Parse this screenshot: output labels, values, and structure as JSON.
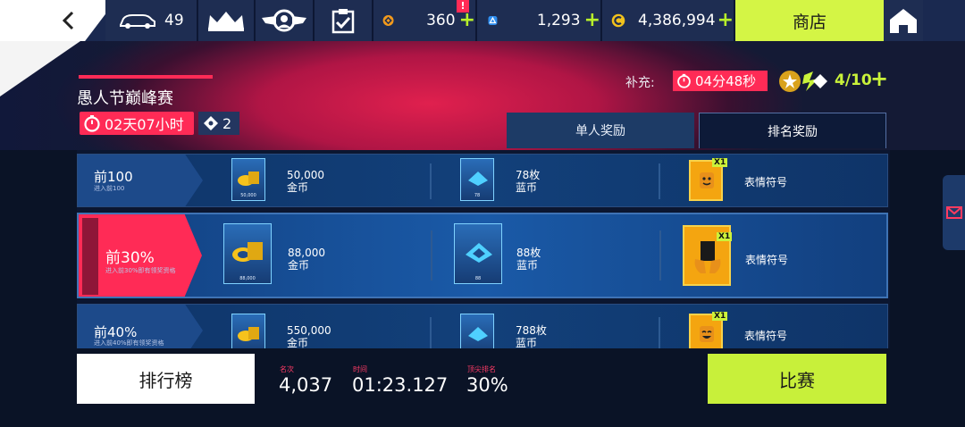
{
  "topbar": {
    "car_count": "49",
    "tokens": "360",
    "blueprints": "1,293",
    "credits": "4,386,994",
    "shop_label": "商店",
    "alert_badge": "!"
  },
  "event": {
    "title": "愚人节巅峰赛",
    "time_left": "02天07小时",
    "tickets": "2",
    "refill_label": "补充:",
    "refill_timer": "04分48秒",
    "ticket_count": "4/10"
  },
  "tabs": [
    {
      "label": "单人奖励",
      "active": false
    },
    {
      "label": "排名奖励",
      "active": true
    }
  ],
  "rewards": [
    {
      "rank": "前100",
      "note": "进入前100",
      "gold_amount": "50,000",
      "gold_unit": "金币",
      "gold_card_caption": "50,000",
      "blue_amount": "78枚",
      "blue_unit": "蓝币",
      "blue_card_caption": "78",
      "emote_label": "表情符号",
      "emote_qty": "X1",
      "selected": false
    },
    {
      "rank": "前30%",
      "note": "进入前30%即有领奖资格",
      "gold_amount": "88,000",
      "gold_unit": "金币",
      "gold_card_caption": "88,000",
      "blue_amount": "88枚",
      "blue_unit": "蓝币",
      "blue_card_caption": "88",
      "emote_label": "表情符号",
      "emote_qty": "X1",
      "selected": true
    },
    {
      "rank": "前40%",
      "note": "进入前40%即有领奖资格",
      "gold_amount": "550,000",
      "gold_unit": "金币",
      "gold_card_caption": "",
      "blue_amount": "788枚",
      "blue_unit": "蓝币",
      "blue_card_caption": "",
      "emote_label": "表情符号",
      "emote_qty": "X1",
      "selected": false
    }
  ],
  "bottom": {
    "leaderboard_label": "排行榜",
    "rank_label": "名次",
    "rank_value": "4,037",
    "time_label": "时间",
    "time_value": "01:23.127",
    "top_label": "顶尖排名",
    "top_value": "30%",
    "race_label": "比赛"
  },
  "colors": {
    "accent_pink": "#ff2b56",
    "lime": "#c8f03a",
    "navy": "#0a1326"
  }
}
